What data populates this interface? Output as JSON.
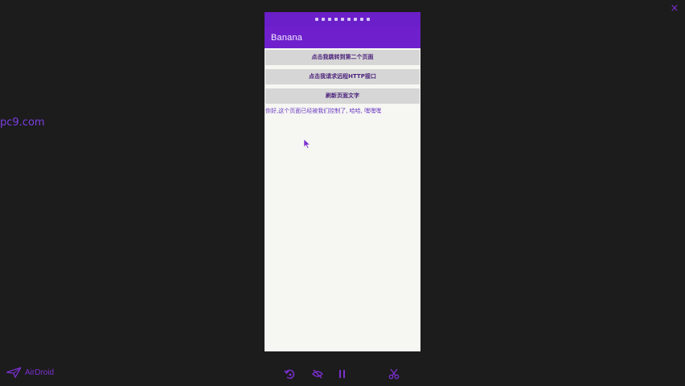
{
  "window": {
    "close_glyph": "×",
    "watermark": "pc9.com"
  },
  "phone": {
    "app_title": "Banana",
    "buttons": [
      {
        "label": "点击我跳转到第二个页面"
      },
      {
        "label": "点击我请求远程HTTP接口"
      },
      {
        "label": "刷新页面文字"
      }
    ],
    "message": "你好,这个页面已经被我们控制了, 哈哈, 嘿嘿嘿"
  },
  "footer": {
    "brand": "AirDroid",
    "tools": [
      {
        "icon": "rotate-left-icon"
      },
      {
        "icon": "eye-hide-icon"
      },
      {
        "icon": "pause-icon"
      },
      {
        "icon": "scissors-icon"
      }
    ]
  },
  "colors": {
    "accent": "#6f20cc",
    "background": "#1c1c1c",
    "screen": "#f6f6f3",
    "button": "#d6d6d6"
  }
}
